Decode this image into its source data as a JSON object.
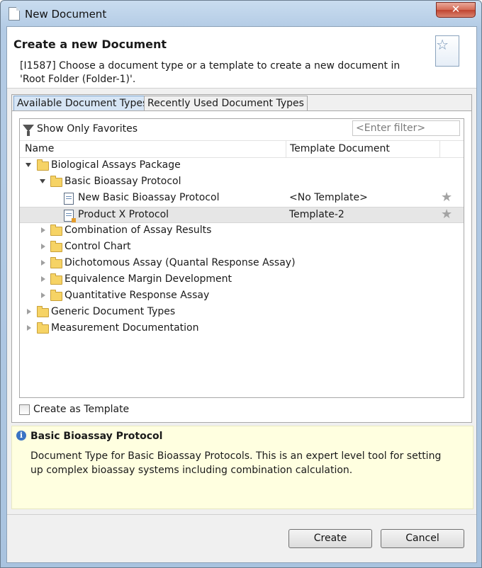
{
  "window": {
    "title": "New Document",
    "close_label": "✕"
  },
  "header": {
    "title": "Create a new Document",
    "message": "[I1587] Choose a document type or a template to create a new document in 'Root Folder (Folder-1)'."
  },
  "tabs": [
    {
      "label": "Available Document Types",
      "active": true
    },
    {
      "label": "Recently Used Document Types",
      "active": false
    }
  ],
  "toolbar": {
    "favorites_label": "Show Only Favorites",
    "filter_placeholder": "<Enter filter>"
  },
  "columns": {
    "name": "Name",
    "template": "Template Document"
  },
  "tree": [
    {
      "label": "Biological Assays Package",
      "type": "folder",
      "expanded": true,
      "level": 0
    },
    {
      "label": "Basic Bioassay Protocol",
      "type": "folder",
      "expanded": true,
      "level": 1
    },
    {
      "label": "New Basic Bioassay Protocol",
      "type": "document",
      "level": 2,
      "template": "<No Template>",
      "favorite": true
    },
    {
      "label": "Product X Protocol",
      "type": "template",
      "level": 2,
      "template": "Template-2",
      "favorite": true,
      "selected": true
    },
    {
      "label": "Combination of Assay Results",
      "type": "folder",
      "expanded": false,
      "level": 1
    },
    {
      "label": "Control Chart",
      "type": "folder",
      "expanded": false,
      "level": 1
    },
    {
      "label": "Dichotomous Assay (Quantal Response Assay)",
      "type": "folder",
      "expanded": false,
      "level": 1
    },
    {
      "label": "Equivalence Margin Development",
      "type": "folder",
      "expanded": false,
      "level": 1
    },
    {
      "label": "Quantitative Response Assay",
      "type": "folder",
      "expanded": false,
      "level": 1
    },
    {
      "label": "Generic Document Types",
      "type": "folder",
      "expanded": false,
      "level": 0
    },
    {
      "label": "Measurement Documentation",
      "type": "folder",
      "expanded": false,
      "level": 0
    }
  ],
  "options": {
    "create_as_template_label": "Create as Template",
    "create_as_template_checked": false
  },
  "description": {
    "title": "Basic Bioassay Protocol",
    "body": "Document Type for Basic Bioassay Protocols. This is an expert level tool for setting up complex bioassay systems including combination calculation."
  },
  "buttons": {
    "create": "Create",
    "cancel": "Cancel"
  },
  "colors": {
    "selection": "#e6e6e6",
    "description_bg": "#ffffe0",
    "active_tab": "#d6e5f5"
  }
}
